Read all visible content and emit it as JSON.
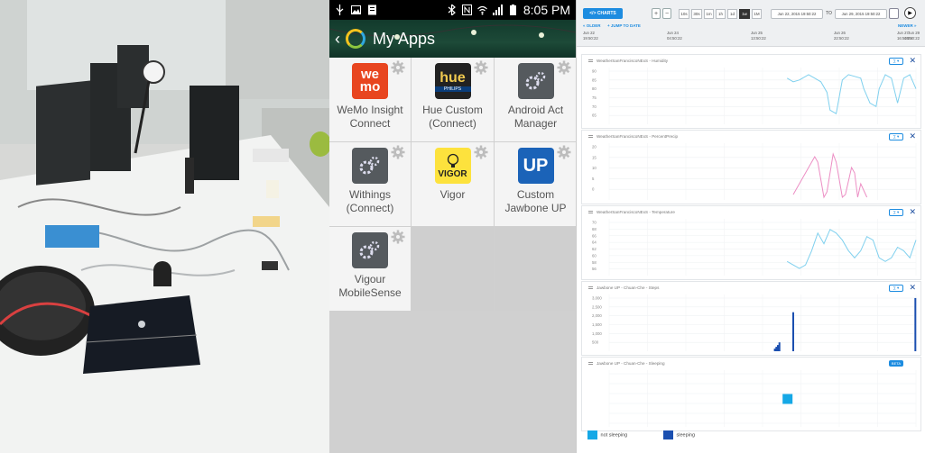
{
  "phone": {
    "status_time": "8:05 PM",
    "title": "My Apps",
    "apps": [
      {
        "label1": "WeMo Insight",
        "label2": "Connect",
        "icon": "wemo-icon",
        "icon_text": "we\nmo"
      },
      {
        "label1": "Hue Custom",
        "label2": "(Connect)",
        "icon": "hue-icon",
        "icon_text": "hue",
        "icon_sub": "PHILIPS"
      },
      {
        "label1": "Android Act",
        "label2": "Manager",
        "icon": "gears-icon"
      },
      {
        "label1": "Withings",
        "label2": "(Connect)",
        "icon": "gears-icon"
      },
      {
        "label1": "Vigor",
        "label2": "",
        "icon": "vigor-icon",
        "icon_text": "VIGOR"
      },
      {
        "label1": "Custom",
        "label2": "Jawbone UP",
        "icon": "jawbone-icon",
        "icon_text": "UP"
      },
      {
        "label1": "Vigour",
        "label2": "MobileSense",
        "icon": "gears-icon"
      }
    ]
  },
  "dashboard": {
    "charts_button": "</> CHARTS",
    "range_buttons": [
      "10s",
      "30s",
      "1m",
      "1h",
      "1d",
      "1w",
      "1M"
    ],
    "active_range": "1w",
    "date_from": "Jun 22, 2015 19:50:22",
    "date_to_label": "TO",
    "date_to": "Jun 29, 2015 19:50:22",
    "older_link": "« OLDER",
    "jump_link": "+ JUMP TO DATE",
    "newer_link": "NEWER »",
    "timeline": [
      {
        "d": "Jun 22",
        "t": "19:50:22"
      },
      {
        "d": "Jun 24",
        "t": "04:50:22"
      },
      {
        "d": "Jun 25",
        "t": "13:50:22"
      },
      {
        "d": "Jun 26",
        "t": "22:50:22"
      },
      {
        "d": "Jun 27",
        "t": "16:50:22"
      },
      {
        "d": "Jun 29",
        "t": "19:50:22"
      }
    ],
    "legend": [
      {
        "label": "not sleeping",
        "color": "#15a8e6"
      },
      {
        "label": "sleeping",
        "color": "#1b4fb0"
      }
    ],
    "panel_ctrl": "∑",
    "beta": "BETA"
  },
  "chart_data": [
    {
      "type": "line",
      "title": "WeatherSanFranciscoNExS - Humidity",
      "color": "#7fd0ee",
      "yticks": [
        "90",
        "85",
        "80",
        "75",
        "70",
        "65"
      ],
      "ylim": [
        60,
        92
      ],
      "x": [
        0.58,
        0.6,
        0.62,
        0.65,
        0.67,
        0.69,
        0.71,
        0.72,
        0.74,
        0.76,
        0.78,
        0.8,
        0.82,
        0.83,
        0.85,
        0.87,
        0.88,
        0.9,
        0.92,
        0.94,
        0.96,
        0.98,
        1.0
      ],
      "values": [
        86,
        84,
        85,
        88,
        86,
        84,
        78,
        68,
        66,
        85,
        88,
        87,
        86,
        80,
        72,
        70,
        80,
        88,
        86,
        72,
        86,
        88,
        80
      ]
    },
    {
      "type": "line",
      "title": "WeatherSanFranciscoNExS - PercentPrecip",
      "color": "#ec8ec4",
      "yticks": [
        "20",
        "15",
        "10",
        "5",
        "0"
      ],
      "ylim": [
        0,
        21
      ],
      "x": [
        0.6,
        0.63,
        0.65,
        0.67,
        0.68,
        0.7,
        0.71,
        0.73,
        0.74,
        0.76,
        0.77,
        0.79,
        0.8,
        0.81,
        0.82,
        0.84
      ],
      "values": [
        2,
        8,
        12,
        16,
        14,
        1,
        3,
        17,
        14,
        1,
        2,
        12,
        10,
        1,
        6,
        1
      ]
    },
    {
      "type": "line",
      "title": "WeatherSanFranciscoNExS - Temperature",
      "color": "#7fd0ee",
      "yticks": [
        "70",
        "68",
        "66",
        "64",
        "62",
        "60",
        "58",
        "56"
      ],
      "ylim": [
        55,
        71
      ],
      "x": [
        0.58,
        0.6,
        0.62,
        0.64,
        0.66,
        0.68,
        0.7,
        0.72,
        0.74,
        0.76,
        0.78,
        0.8,
        0.82,
        0.84,
        0.86,
        0.88,
        0.9,
        0.92,
        0.94,
        0.96,
        0.98,
        1.0
      ],
      "values": [
        59,
        58,
        57,
        58,
        62,
        67,
        64,
        68,
        67,
        65,
        62,
        60,
        62,
        66,
        65,
        60,
        59,
        60,
        63,
        62,
        60,
        65
      ]
    },
    {
      "type": "bar",
      "title": "Jawbone UP - Chuan-Che - Steps",
      "color": "#1b4fb0",
      "yticks": [
        "3,000",
        "2,500",
        "2,000",
        "1,500",
        "1,000",
        "500"
      ],
      "ylim": [
        0,
        3200
      ],
      "x": [
        0.54,
        0.545,
        0.55,
        0.555,
        0.6,
        0.998
      ],
      "values": [
        150,
        250,
        350,
        500,
        2200,
        3000
      ]
    },
    {
      "type": "scatter",
      "title": "Jawbone UP - Chuan-Che - Sleeping",
      "color": "#15a8e6",
      "yticks": [],
      "ylim": [
        0,
        1
      ],
      "x": [
        0.58
      ],
      "values": [
        0.5
      ]
    }
  ]
}
